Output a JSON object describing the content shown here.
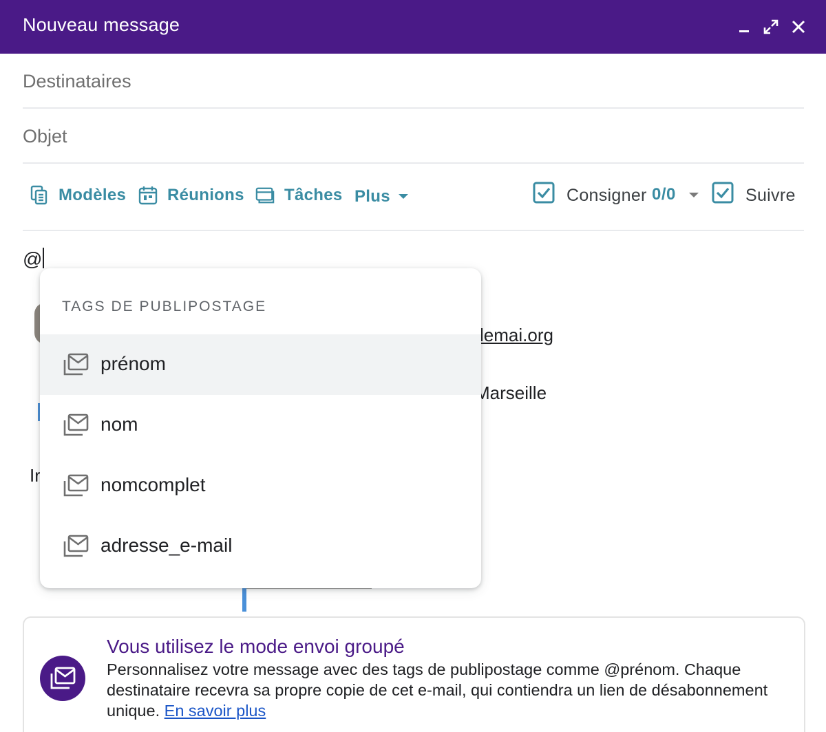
{
  "window": {
    "title": "Nouveau message"
  },
  "fields": {
    "to_placeholder": "Destinataires",
    "subject_placeholder": "Objet"
  },
  "toolbar": {
    "templates": "Modèles",
    "meetings": "Réunions",
    "tasks": "Tâches",
    "more": "Plus",
    "log_label": "Consigner",
    "log_counter": "0/0",
    "track_label": "Suivre"
  },
  "body": {
    "typed_text": "@",
    "fragment_email": "lemai.org",
    "fragment_city": "Marseille",
    "fragment_ir": "Ir"
  },
  "dropdown": {
    "title": "TAGS DE PUBLIPOSTAGE",
    "items": [
      {
        "label": "prénom",
        "icon": "mail-merge-icon",
        "active": true
      },
      {
        "label": "nom",
        "icon": "mail-merge-icon",
        "active": false
      },
      {
        "label": "nomcomplet",
        "icon": "mail-merge-icon",
        "active": false
      },
      {
        "label": "adresse_e-mail",
        "icon": "mail-merge-icon",
        "active": false
      }
    ]
  },
  "banner": {
    "title": "Vous utilisez le mode envoi groupé",
    "text": "Personnalisez votre message avec des tags de publipostage comme @prénom. Chaque destinataire recevra sa propre copie de cet e-mail, qui contiendra un lien de désabonnement unique.",
    "link": "En savoir plus"
  },
  "colors": {
    "header_bg": "#4a1a87",
    "accent_teal": "#3a8ca3",
    "link_blue": "#1a55c7"
  }
}
